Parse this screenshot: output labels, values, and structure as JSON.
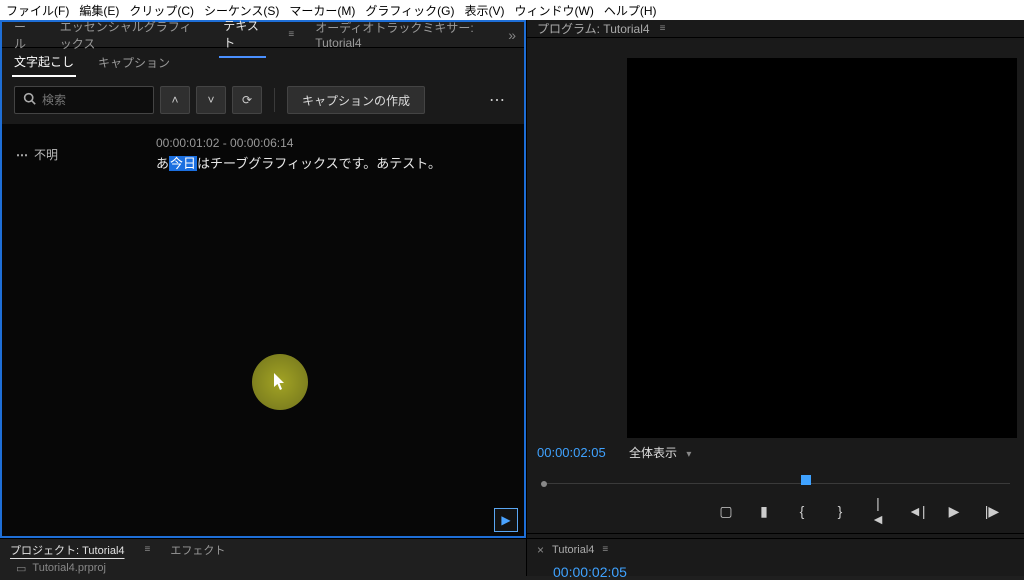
{
  "menu": {
    "file": "ファイル(F)",
    "edit": "編集(E)",
    "clip": "クリップ(C)",
    "sequence": "シーケンス(S)",
    "marker": "マーカー(M)",
    "graphic": "グラフィック(G)",
    "view": "表示(V)",
    "window": "ウィンドウ(W)",
    "help": "ヘルプ(H)"
  },
  "left_tabs": {
    "partial": "ール",
    "eg": "エッセンシャルグラフィックス",
    "text": "テキスト",
    "mixer": "オーディオトラックミキサー: Tutorial4"
  },
  "subtabs": {
    "transcribe": "文字起こし",
    "caption": "キャプション"
  },
  "toolbar": {
    "search_placeholder": "検索",
    "create_caption": "キャプションの作成"
  },
  "transcript": {
    "speaker": "不明",
    "time": "00:00:01:02 - 00:00:06:14",
    "text_pre": "あ",
    "text_hl": "今日",
    "text_post": "はチーブグラフィックスです。あテスト。"
  },
  "project": {
    "tab_project": "プロジェクト: Tutorial4",
    "tab_effects": "エフェクト",
    "filename": "Tutorial4.prproj"
  },
  "program": {
    "tab": "プログラム: Tutorial4",
    "timecode": "00:00:02:05",
    "zoom": "全体表示"
  },
  "sequence": {
    "name": "Tutorial4",
    "timecode": "00:00:02:05"
  }
}
